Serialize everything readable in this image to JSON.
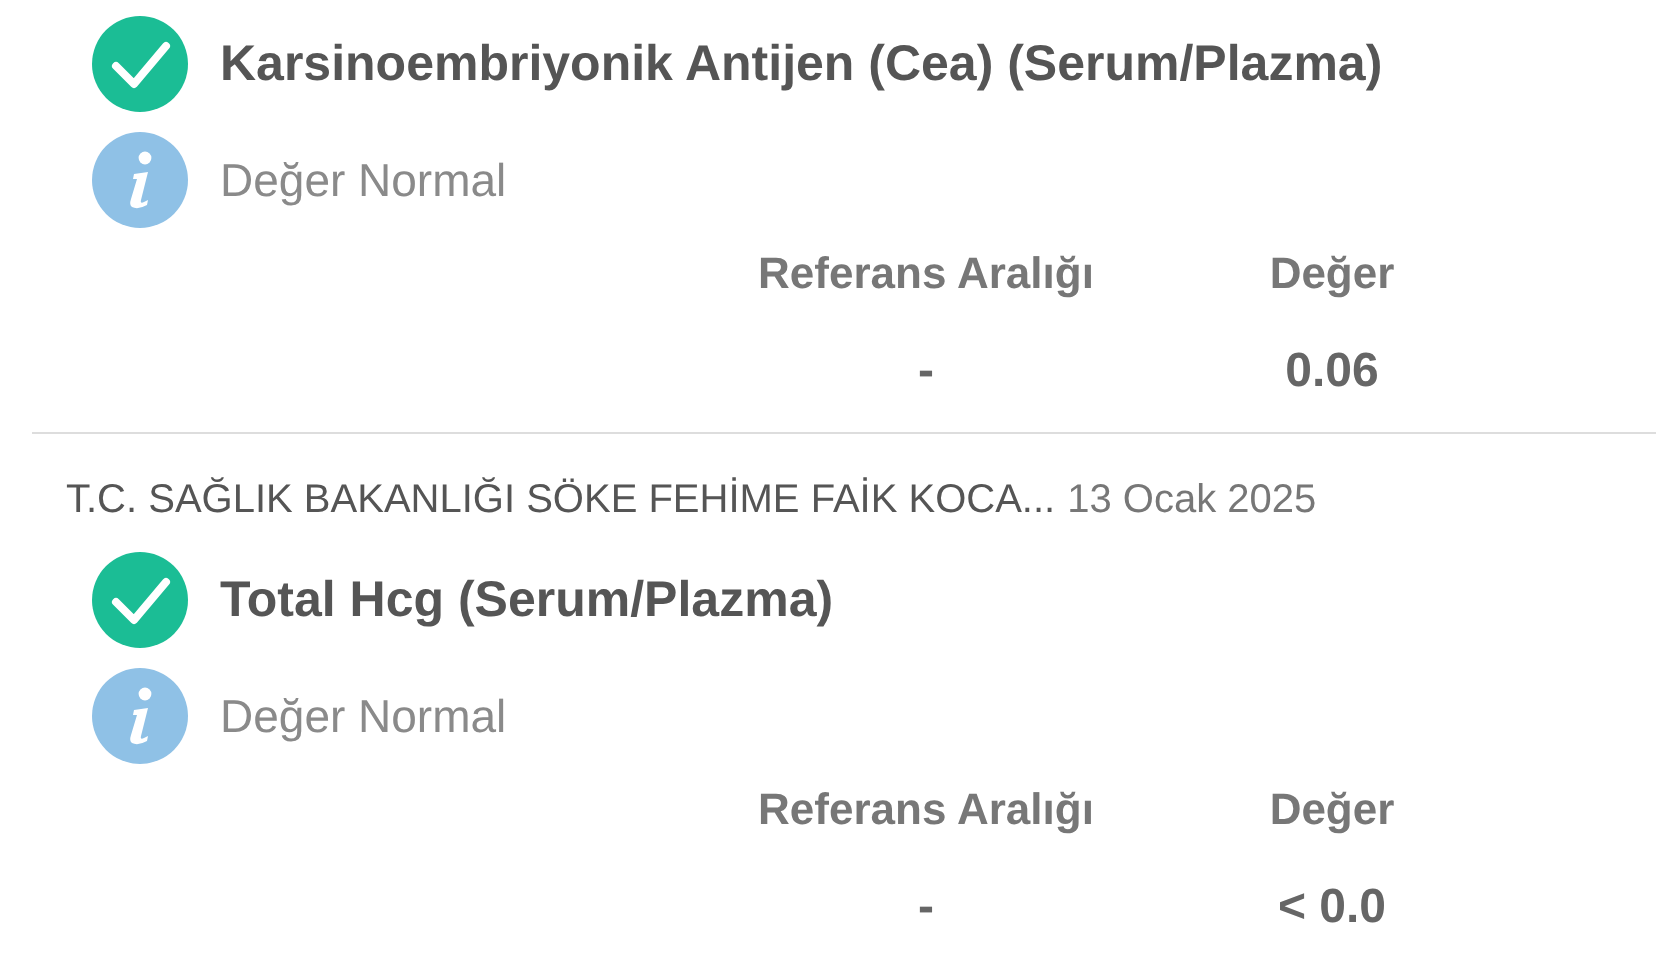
{
  "results": [
    {
      "title": "Karsinoembriyonik Antijen (Cea) (Serum/Plazma)",
      "note": "Değer Normal",
      "range_label": "Referans Aralığı",
      "value_label": "Değer",
      "range": "-",
      "value": "0.06"
    },
    {
      "source": "T.C. SAĞLIK BAKANLIĞI SÖKE FEHİME FAİK KOCA...",
      "date": "13 Ocak 2025",
      "title": "Total Hcg (Serum/Plazma)",
      "note": "Değer Normal",
      "range_label": "Referans Aralığı",
      "value_label": "Değer",
      "range": "-",
      "value": "< 0.0"
    }
  ]
}
